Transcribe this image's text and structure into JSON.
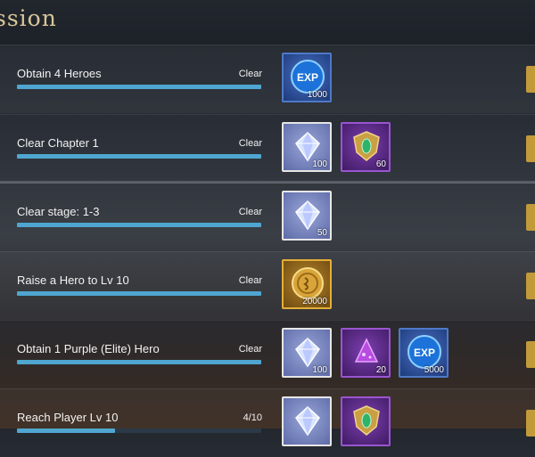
{
  "header": {
    "title": "ssion"
  },
  "missions": [
    {
      "name": "Obtain 4 Heroes",
      "status": "Clear",
      "progress": 1.0,
      "rewards": [
        {
          "icon": "exp-orb-icon",
          "frame": "blue",
          "qty": "1000"
        }
      ]
    },
    {
      "name": "Clear Chapter 1",
      "status": "Clear",
      "progress": 1.0,
      "rewards": [
        {
          "icon": "diamond-icon",
          "frame": "white",
          "qty": "100"
        },
        {
          "icon": "emerald-shield-icon",
          "frame": "purple",
          "qty": "60"
        }
      ]
    },
    {
      "name": "Clear stage: 1-3",
      "status": "Clear",
      "progress": 1.0,
      "rewards": [
        {
          "icon": "diamond-icon",
          "frame": "white",
          "qty": "50"
        }
      ]
    },
    {
      "name": "Raise a Hero to Lv 10",
      "status": "Clear",
      "progress": 1.0,
      "rewards": [
        {
          "icon": "gold-coin-icon",
          "frame": "gold",
          "qty": "20000"
        }
      ]
    },
    {
      "name": "Obtain 1 Purple (Elite) Hero",
      "status": "Clear",
      "progress": 1.0,
      "rewards": [
        {
          "icon": "diamond-icon",
          "frame": "white",
          "qty": "100"
        },
        {
          "icon": "purple-dust-icon",
          "frame": "purple",
          "qty": "20"
        },
        {
          "icon": "exp-orb-icon",
          "frame": "blue",
          "qty": "5000"
        }
      ]
    },
    {
      "name": "Reach Player Lv 10",
      "status": "4/10",
      "progress": 0.4,
      "rewards": [
        {
          "icon": "diamond-icon",
          "frame": "white",
          "qty": ""
        },
        {
          "icon": "emerald-shield-icon",
          "frame": "purple",
          "qty": ""
        }
      ]
    }
  ]
}
